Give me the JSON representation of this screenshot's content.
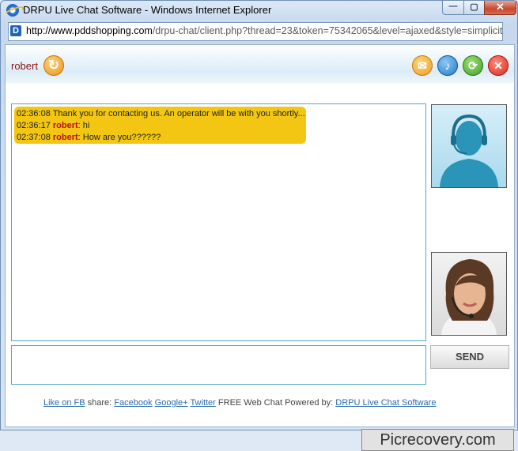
{
  "window": {
    "title": "DRPU Live Chat Software - Windows Internet Explorer",
    "url_domain": "http://www.pddshopping.com",
    "url_path": "/drpu-chat/client.php?thread=23&token=75342065&level=ajaxed&style=simplicit",
    "min_glyph": "—",
    "max_glyph": "▢",
    "close_glyph": "✕"
  },
  "chat": {
    "username": "robert",
    "icons": {
      "refresh": "refresh-icon",
      "mail": "mail-icon",
      "sound": "speaker-icon",
      "sync": "sync-icon",
      "exit": "close-icon"
    },
    "messages": [
      {
        "time": "02:36:08",
        "sender": "",
        "text": "Thank you for contacting us. An operator will be with you shortly..."
      },
      {
        "time": "02:36:17",
        "sender": "robert",
        "text": ": hi"
      },
      {
        "time": "02:37:08",
        "sender": "robert",
        "text": ": How are you??????"
      }
    ],
    "send_label": "SEND",
    "bubble_color": "#f2c612"
  },
  "footer": {
    "like_fb": "Like on FB",
    "share_label": "share:",
    "facebook": "Facebook",
    "googleplus": "Google+",
    "twitter": "Twitter",
    "powered_by": "FREE Web Chat Powered by:",
    "powered_link": "DRPU Live Chat Software"
  },
  "watermark": "Picrecovery.com"
}
